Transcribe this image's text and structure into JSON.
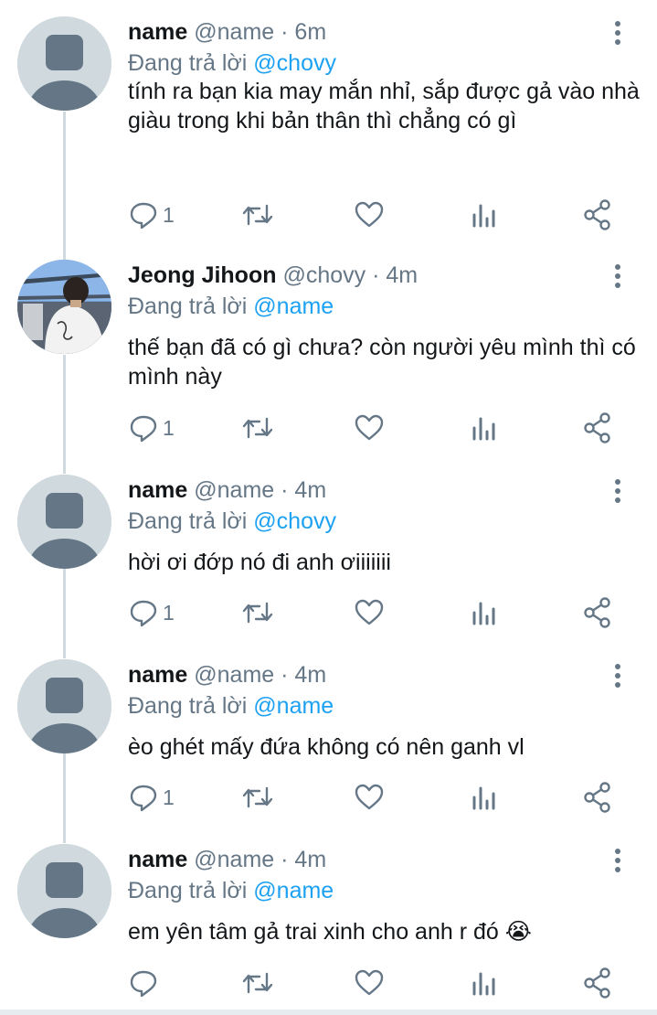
{
  "reply_prefix": "Đang trả lời",
  "tweets": [
    {
      "name": "name",
      "handle": "@name",
      "separator": "·",
      "time": "6m",
      "reply_to": "@chovy",
      "text": "tính ra bạn kia may mắn nhỉ, sắp được gả vào nhà giàu trong khi bản thân thì chẳng có gì",
      "reply_count": "1",
      "avatar": "default-avatar"
    },
    {
      "name": "Jeong Jihoon",
      "handle": "@chovy",
      "separator": "·",
      "time": "4m",
      "reply_to": "@name",
      "text": "thế bạn đã có gì chưa? còn người yêu mình thì có mình này",
      "reply_count": "1",
      "avatar": "photo-avatar"
    },
    {
      "name": "name",
      "handle": "@name",
      "separator": "·",
      "time": "4m",
      "reply_to": "@chovy",
      "text": "hời ơi đớp nó đi anh ơiiiiiii",
      "reply_count": "1",
      "avatar": "default-avatar"
    },
    {
      "name": "name",
      "handle": "@name",
      "separator": "·",
      "time": "4m",
      "reply_to": "@name",
      "text": "èo ghét mấy đứa không có nên ganh vl",
      "reply_count": "1",
      "avatar": "default-avatar"
    },
    {
      "name": "name",
      "handle": "@name",
      "separator": "·",
      "time": "4m",
      "reply_to": "@name",
      "text": "em yên tâm gả trai xinh cho anh r đó 😭",
      "reply_count": "",
      "avatar": "default-avatar"
    }
  ],
  "colors": {
    "text": "#14171a",
    "secondary": "#657786",
    "mention": "#1da1f2",
    "avatar_bg": "#cfd9de",
    "avatar_fg": "#657786",
    "thread_line": "#cfd9de"
  }
}
